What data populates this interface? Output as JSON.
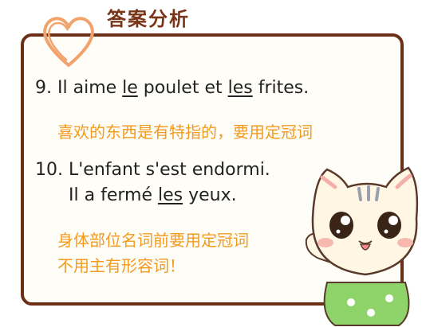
{
  "header": {
    "title": "答案分析"
  },
  "items": [
    {
      "number": "9.",
      "parts": [
        "Il aime ",
        "le",
        " poulet et ",
        "les",
        " frites."
      ],
      "note": "喜欢的东西是有特指的，要用定冠词"
    },
    {
      "number": "10.",
      "line1": "L'enfant s'est endormi.",
      "line2_parts": [
        "Il a fermé ",
        "les",
        " yeux."
      ],
      "note_lines": [
        "身体部位名词前要用定冠词",
        "不用主有形容词！"
      ]
    }
  ],
  "colors": {
    "border": "#6b2f18",
    "note": "#f39a1e",
    "heart": "#f2a36b",
    "title": "#7a3418"
  },
  "icons": {
    "heart": "heart-doodle-icon",
    "cat": "cat-mascot-illustration"
  }
}
